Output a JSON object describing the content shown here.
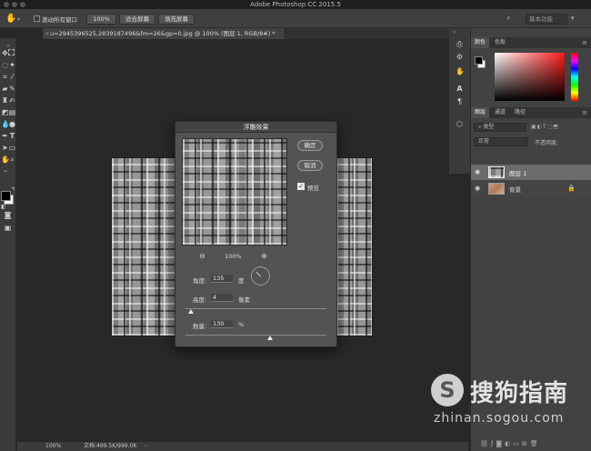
{
  "window": {
    "title": "Adobe Photoshop CC 2015.5"
  },
  "options": {
    "scroll_all_label": "滚动所有窗口",
    "zoom_label": "100%",
    "fit_screen_label": "适合屏幕",
    "fill_screen_label": "填充屏幕",
    "workspace_label": "基本功能"
  },
  "document": {
    "tab_title": "u=2945396525,2839187496&fm=26&gp=0.jpg @ 100% (图层 1, RGB/8#) *"
  },
  "status": {
    "zoom": "100%",
    "doc_size": "文档:499.5K/999.0K"
  },
  "panels": {
    "color_tabs": [
      "颜色",
      "色板"
    ],
    "layers_tabs": [
      "图层",
      "通道",
      "路径"
    ],
    "kind_label": "类型",
    "blend_mode": "正常",
    "opacity_label": "不透明度:",
    "layers": [
      {
        "name": "图层 1",
        "selected": true
      },
      {
        "name": "背景",
        "locked": true
      }
    ]
  },
  "dialog": {
    "title": "浮雕效果",
    "ok_label": "确定",
    "cancel_label": "取消",
    "preview_label": "预览",
    "preview_checked": true,
    "zoom_percent": "100%",
    "angle_label": "角度:",
    "angle_value": "135",
    "angle_unit": "度",
    "height_label": "高度:",
    "height_value": "4",
    "height_unit": "像素",
    "amount_label": "数量:",
    "amount_value": "130",
    "amount_unit": "%",
    "height_slider_fraction": 0.04,
    "amount_slider_fraction": 0.6
  },
  "watermark": {
    "logo_glyph": "S",
    "brand_text": "搜狗指南",
    "url_text": "zhinan.sogou.com"
  },
  "colors": {
    "app_bg": "#282828",
    "panel_bg": "#424242",
    "dialog_bg": "#535353",
    "foreground_swatch": "#000000",
    "background_swatch": "#ffffff"
  }
}
